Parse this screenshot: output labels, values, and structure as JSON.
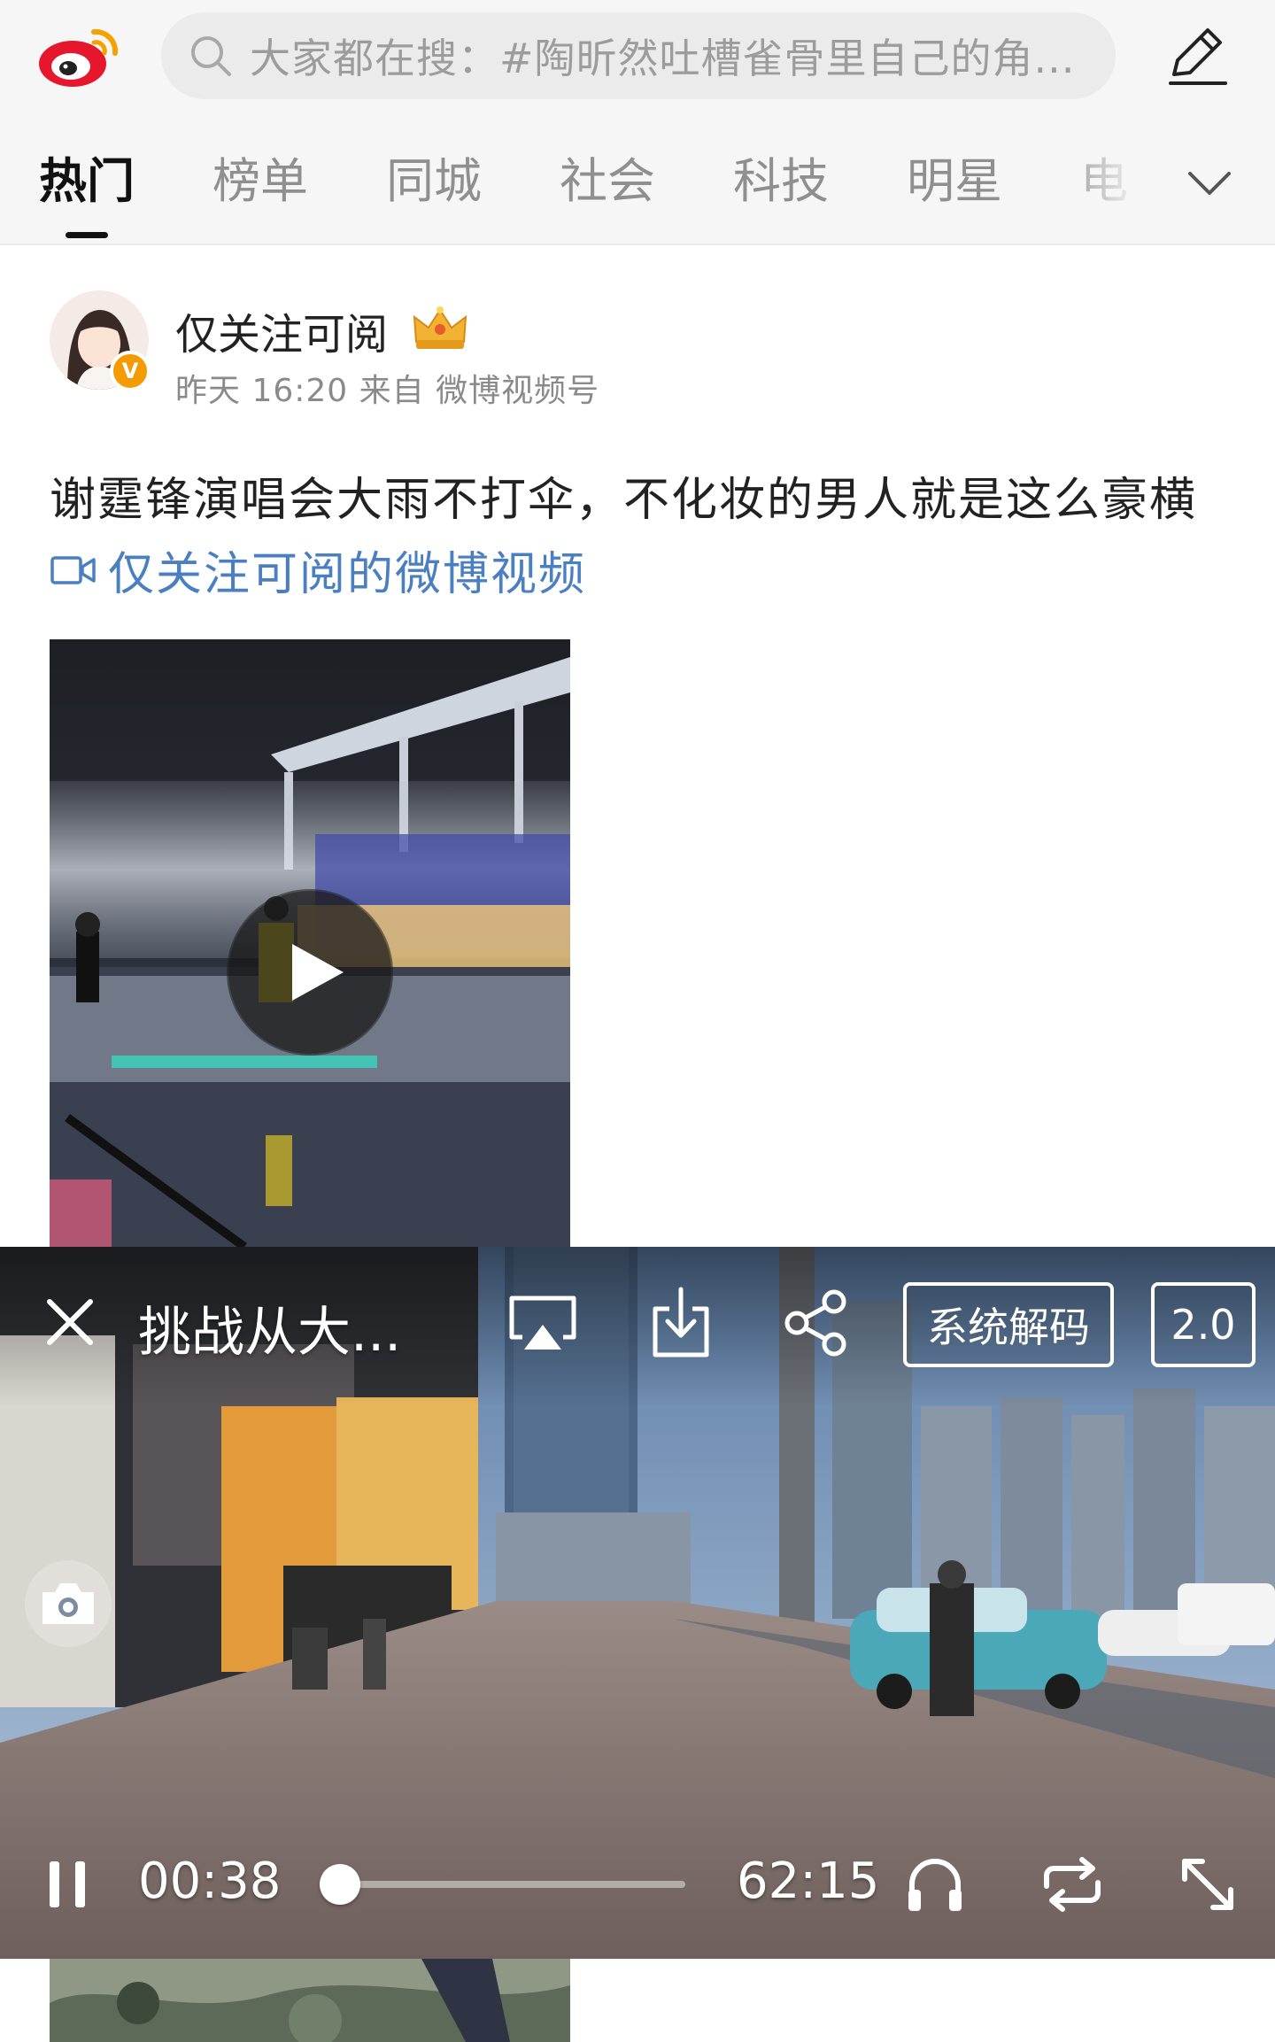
{
  "search": {
    "placeholder": "大家都在搜：#陶昕然吐槽雀骨里自己的角..."
  },
  "tabs": [
    {
      "label": "热门"
    },
    {
      "label": "榜单"
    },
    {
      "label": "同城"
    },
    {
      "label": "社会"
    },
    {
      "label": "科技"
    },
    {
      "label": "明星"
    },
    {
      "label": "电"
    }
  ],
  "icons": {
    "logo": "weibo-logo",
    "search": "search-icon",
    "compose": "pencil-icon",
    "more": "chevron-down-icon",
    "verified": "verified-v-badge",
    "crown": "crown-icon",
    "video_link": "video-camera-icon",
    "play": "play-icon",
    "close": "close-icon",
    "airplay": "airplay-icon",
    "download": "download-icon",
    "share": "share-icon",
    "camera": "camera-icon",
    "pause": "pause-icon",
    "audio": "headphones-icon",
    "loop": "loop-icon",
    "expand": "expand-icon"
  },
  "post": {
    "username": "仅关注可阅",
    "verified_badge": "V",
    "meta": "昨天 16:20 来自 微博视频号",
    "text": "谢霆锋演唱会大雨不打伞，不化妆的男人就是这么豪横",
    "video_link": "仅关注可阅的微博视频"
  },
  "player": {
    "title": "挑战从大...",
    "decode_label": "系统解码",
    "speed_label": "2.0",
    "current_time": "00:38",
    "duration": "62:15",
    "progress_fraction": 0.01
  },
  "colors": {
    "link": "#4a7fc1",
    "weibo_red": "#e6162d",
    "verified_orange": "#f59a00"
  }
}
